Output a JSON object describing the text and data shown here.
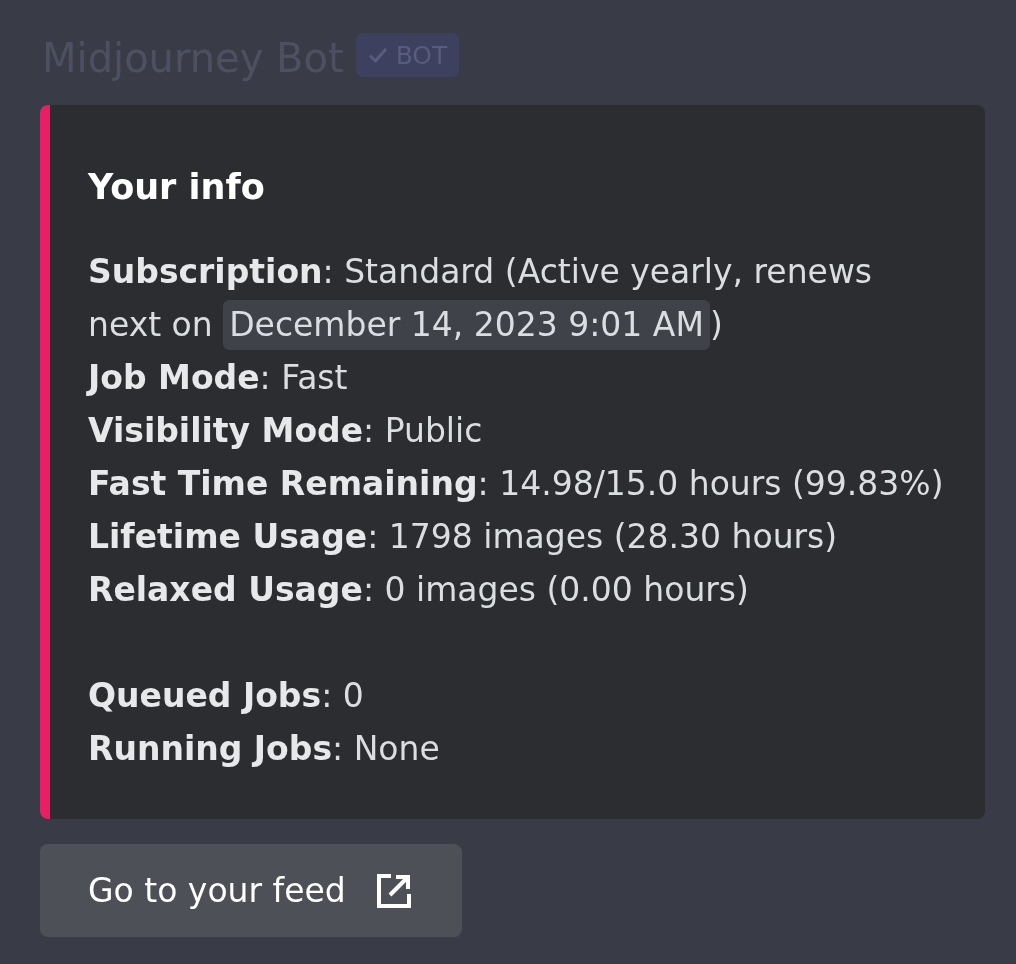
{
  "author": {
    "name": "Midjourney Bot",
    "badge": {
      "label": "BOT",
      "verified": true
    }
  },
  "embed": {
    "title": "Your info",
    "sections": [
      {
        "lines": [
          {
            "text": "**Subscription**: Standard (Active yearly, renews next on ",
            "timestamp": "December 14, 2023 9:01 AM",
            "after": ")"
          },
          {
            "text": "**Job Mode**: Fast"
          },
          {
            "text": "**Visibility Mode**: Public"
          },
          {
            "text": "**Fast Time Remaining**: 14.98/15.0 hours (99.83%)"
          },
          {
            "text": "**Lifetime Usage**: 1798 images (28.30 hours)"
          },
          {
            "text": "**Relaxed Usage**: 0 images (0.00 hours)"
          }
        ]
      },
      {
        "lines": [
          {
            "text": "**Queued Jobs**: 0"
          },
          {
            "text": "**Running Jobs**: None"
          }
        ]
      }
    ]
  },
  "button": {
    "label": "Go to your feed",
    "external": true
  }
}
